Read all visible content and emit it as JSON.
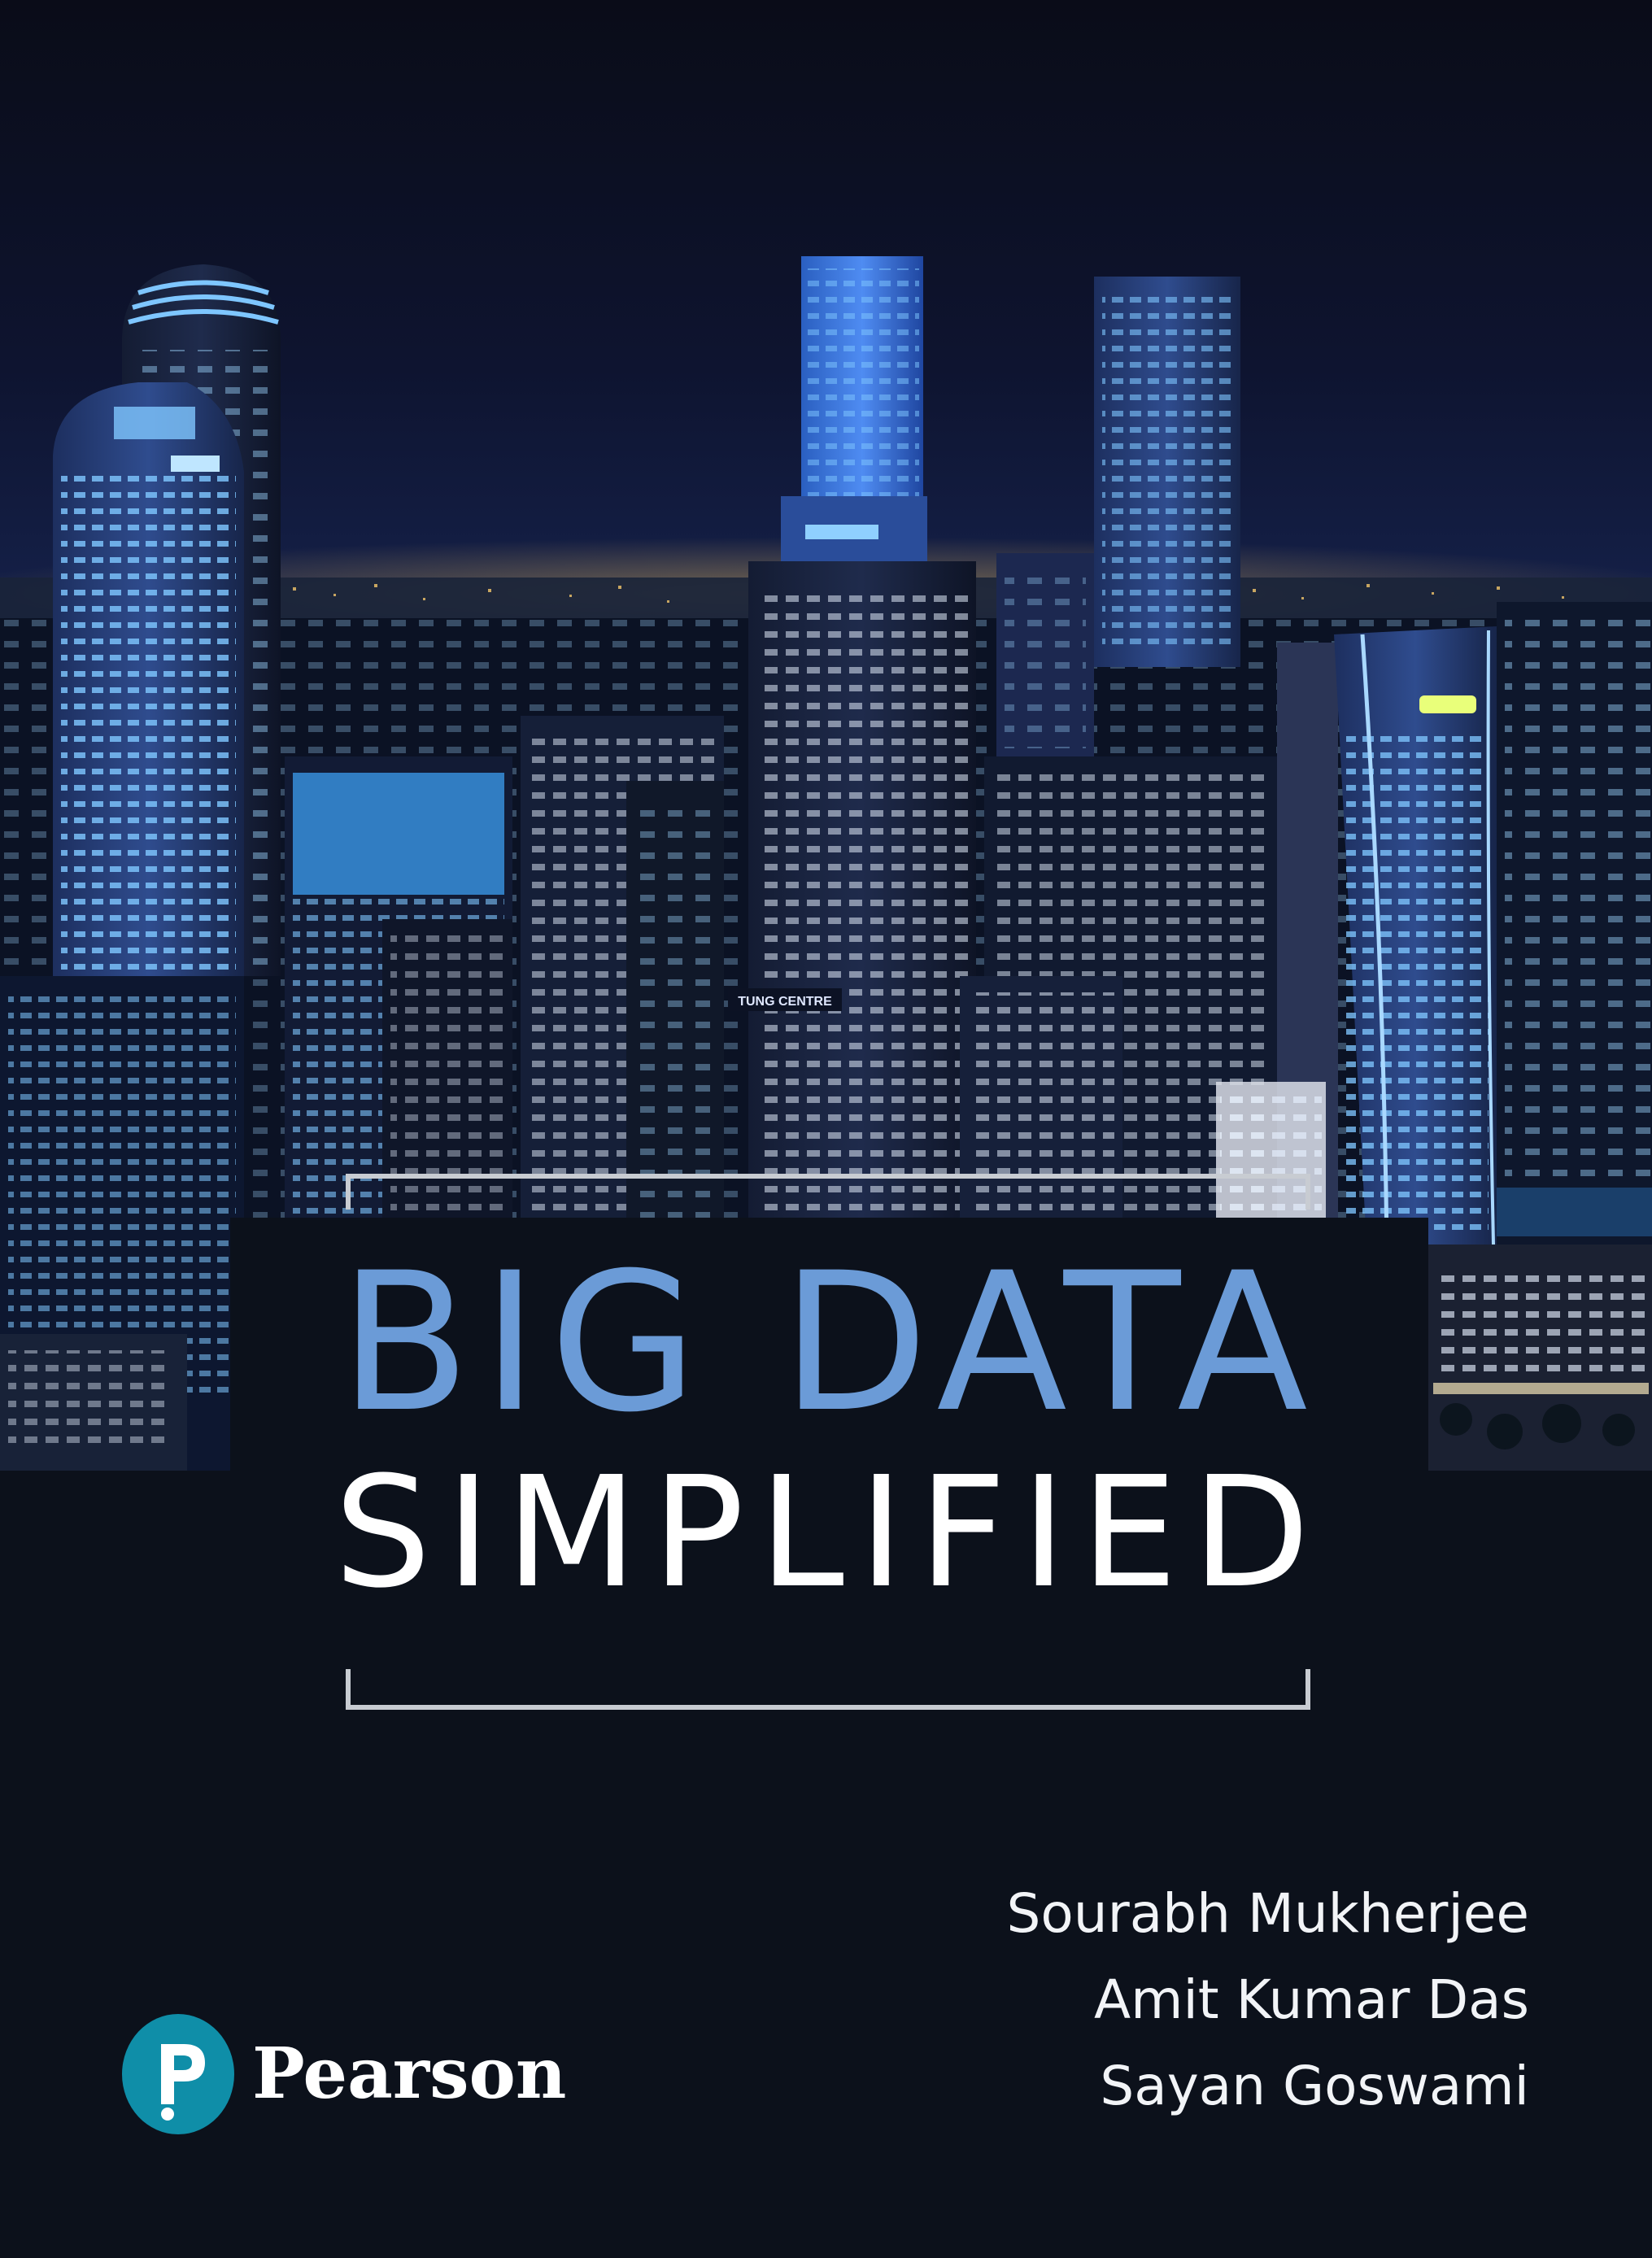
{
  "cover": {
    "title_line_1": "BIG DATA",
    "title_line_2": "SIMPLIFIED",
    "authors": [
      "Sourabh Mukherjee",
      "Amit Kumar Das",
      "Sayan Goswami"
    ],
    "publisher": "Pearson",
    "sign_text": "TUNG CENTRE"
  },
  "colors": {
    "background": "#0c111b",
    "title_accent": "#6b9bd7",
    "title_secondary": "#ffffff",
    "bracket": "#c8ccd2",
    "logo_teal": "#0f8ea8"
  },
  "icons": {
    "publisher_logo": "pearson-p-logo-icon"
  }
}
